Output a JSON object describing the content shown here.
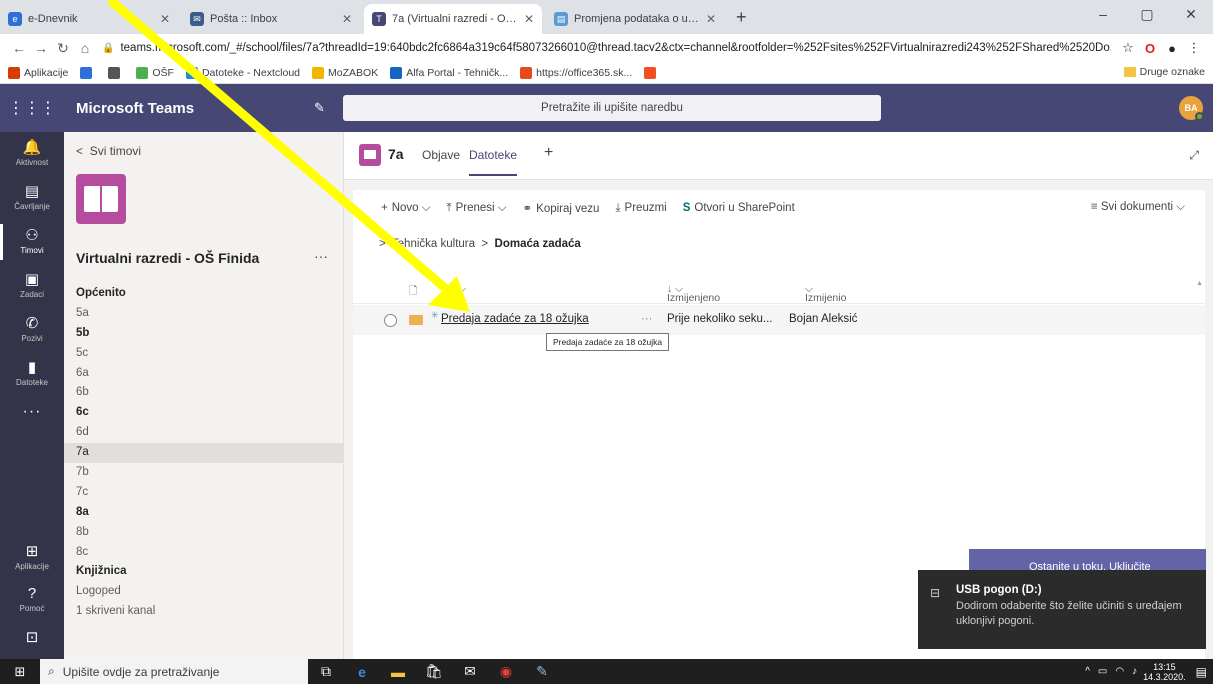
{
  "browser": {
    "tabs": [
      {
        "title": "e-Dnevnik",
        "color": "#2f6fd8",
        "glyph": "e"
      },
      {
        "title": "Pošta :: Inbox",
        "color": "#3b5b8c",
        "glyph": "✉"
      },
      {
        "title": "7a (Virtualni razredi - OŠ Finida) | ",
        "color": "#464775",
        "glyph": "T"
      },
      {
        "title": "Promjena podataka o učeniku",
        "color": "#5a9bd5",
        "glyph": "▤"
      }
    ],
    "address": "teams.microsoft.com/_#/school/files/7a?threadId=19:640bdc2fc6864a319c64f58073266010@thread.tacv2&ctx=channel&rootfolder=%252Fsites%252FVirtualnirazredi243%252FShared%2520Do...",
    "bookmarks": [
      "Aplikacije",
      "",
      "",
      "OŠF",
      "Datoteke - Nextcloud",
      "MoZABOK",
      "Alfa Portal - Tehničk...",
      "https://office365.sk...",
      ""
    ],
    "bookmarks_other": "Druge oznake"
  },
  "teams": {
    "brand": "Microsoft Teams",
    "search_placeholder": "Pretražite ili upišite naredbu",
    "avatar_initials": "BA",
    "appbar": [
      {
        "label": "Aktivnost",
        "icon": "bell-icon",
        "glyph": "🔔"
      },
      {
        "label": "Čavrljanje",
        "icon": "chat-icon",
        "glyph": "▤"
      },
      {
        "label": "Timovi",
        "icon": "teams-icon",
        "glyph": "⚇"
      },
      {
        "label": "Zadaci",
        "icon": "assignments-icon",
        "glyph": "▣"
      },
      {
        "label": "Pozivi",
        "icon": "phone-icon",
        "glyph": "✆"
      },
      {
        "label": "Datoteke",
        "icon": "files-icon",
        "glyph": "▮"
      }
    ],
    "appbar_bottom": [
      {
        "label": "Aplikacije",
        "icon": "apps-icon",
        "glyph": "⊞"
      },
      {
        "label": "Pomoć",
        "icon": "help-icon",
        "glyph": "?"
      }
    ],
    "back_label": "Svi timovi",
    "team_name": "Virtualni razredi - OŠ Finida",
    "channels": [
      {
        "name": "Općenito",
        "style": "heading"
      },
      {
        "name": "5a",
        "style": ""
      },
      {
        "name": "5b",
        "style": "bold"
      },
      {
        "name": "5c",
        "style": ""
      },
      {
        "name": "6a",
        "style": ""
      },
      {
        "name": "6b",
        "style": ""
      },
      {
        "name": "6c",
        "style": "bold"
      },
      {
        "name": "6d",
        "style": ""
      },
      {
        "name": "7a",
        "style": "sel"
      },
      {
        "name": "7b",
        "style": ""
      },
      {
        "name": "7c",
        "style": ""
      },
      {
        "name": "8a",
        "style": "bold"
      },
      {
        "name": "8b",
        "style": ""
      },
      {
        "name": "8c",
        "style": ""
      },
      {
        "name": "Knjižnica",
        "style": "bold"
      },
      {
        "name": "Logoped",
        "style": ""
      },
      {
        "name": "1 skriveni kanal",
        "style": ""
      }
    ],
    "channel_header": {
      "title": "7a",
      "tabs": [
        "Objave",
        "Datoteke"
      ]
    },
    "toolbar": {
      "new": "Novo",
      "upload": "Prenesi",
      "copy_link": "Kopiraj vezu",
      "download": "Preuzmi",
      "open_sharepoint": "Otvori u SharePoint",
      "view": "Svi dokumenti"
    },
    "breadcrumb": {
      "parent": "Tehnička kultura",
      "current": "Domaća zadaća"
    },
    "columns": {
      "modified": "Izmijenjeno",
      "modified_by": "Izmijenio"
    },
    "files": [
      {
        "name": "Predaja zadaće za 18 ožujka",
        "more": "···",
        "modified": "Prije nekoliko seku...",
        "modified_by": "Bojan Aleksić"
      }
    ],
    "tooltip": "Predaja zadaće za 18 ožujka"
  },
  "notifications": {
    "behind": "Ostanite u toku. Uključite",
    "title": "USB pogon (D:)",
    "body": "Dodirom odaberite što želite učiniti s uređajem uklonjivi pogoni."
  },
  "taskbar": {
    "search": "Upišite ovdje za pretraživanje",
    "time": "13:15",
    "date": "14.3.2020."
  },
  "colors": {
    "teams_purple": "#464775",
    "appbar": "#33344a",
    "arrow": "#ffff00"
  }
}
